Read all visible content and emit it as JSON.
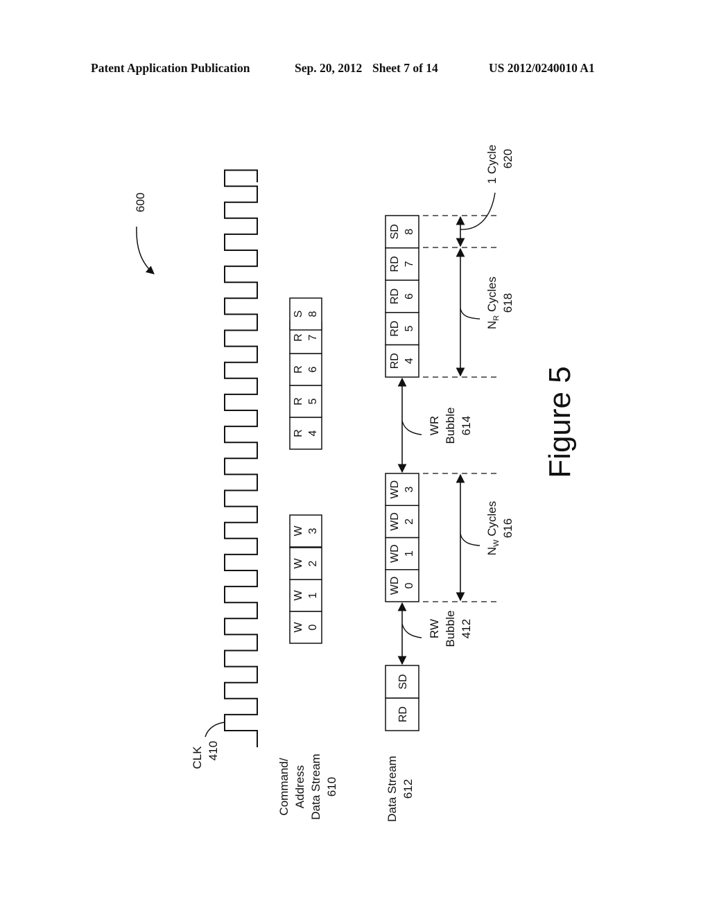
{
  "header": {
    "publication": "Patent Application Publication",
    "date": "Sep. 20, 2012",
    "sheet": "Sheet 7 of 14",
    "number": "US 2012/0240010 A1"
  },
  "figure": {
    "ref": "600",
    "title": "Figure 5",
    "clock": {
      "name": "CLK",
      "ref": "410",
      "cycles": 18
    },
    "command_stream": {
      "name_lines": [
        "Command/",
        "Address",
        "Data Stream",
        "610"
      ],
      "blocks": [
        {
          "op": "W",
          "idx": "0"
        },
        {
          "op": "W",
          "idx": "1"
        },
        {
          "op": "W",
          "idx": "2"
        },
        {
          "op": "W",
          "idx": "3"
        },
        {
          "op": "R",
          "idx": "4"
        },
        {
          "op": "R",
          "idx": "5"
        },
        {
          "op": "R",
          "idx": "6"
        },
        {
          "op": "R",
          "idx": "7"
        },
        {
          "op": "S",
          "idx": "8"
        }
      ]
    },
    "data_stream": {
      "name_lines": [
        "Data Stream",
        "612"
      ],
      "initial_blocks": [
        "RD",
        "SD"
      ],
      "write_blocks": [
        {
          "op": "WD",
          "idx": "0"
        },
        {
          "op": "WD",
          "idx": "1"
        },
        {
          "op": "WD",
          "idx": "2"
        },
        {
          "op": "WD",
          "idx": "3"
        }
      ],
      "read_blocks": [
        {
          "op": "RD",
          "idx": "4"
        },
        {
          "op": "RD",
          "idx": "5"
        },
        {
          "op": "RD",
          "idx": "6"
        },
        {
          "op": "RD",
          "idx": "7"
        },
        {
          "op": "SD",
          "idx": "8"
        }
      ]
    },
    "annotations": {
      "rw_bubble": [
        "RW",
        "Bubble",
        "412"
      ],
      "wr_bubble": [
        "WR",
        "Bubble",
        "614"
      ],
      "nw_cycles": {
        "prefix": "N",
        "sub": "W",
        "text": " Cycles",
        "ref": "616"
      },
      "nr_cycles": {
        "prefix": "N",
        "sub": "R",
        "text": " Cycles",
        "ref": "618"
      },
      "one_cycle": [
        "1 Cycle",
        "620"
      ]
    }
  }
}
